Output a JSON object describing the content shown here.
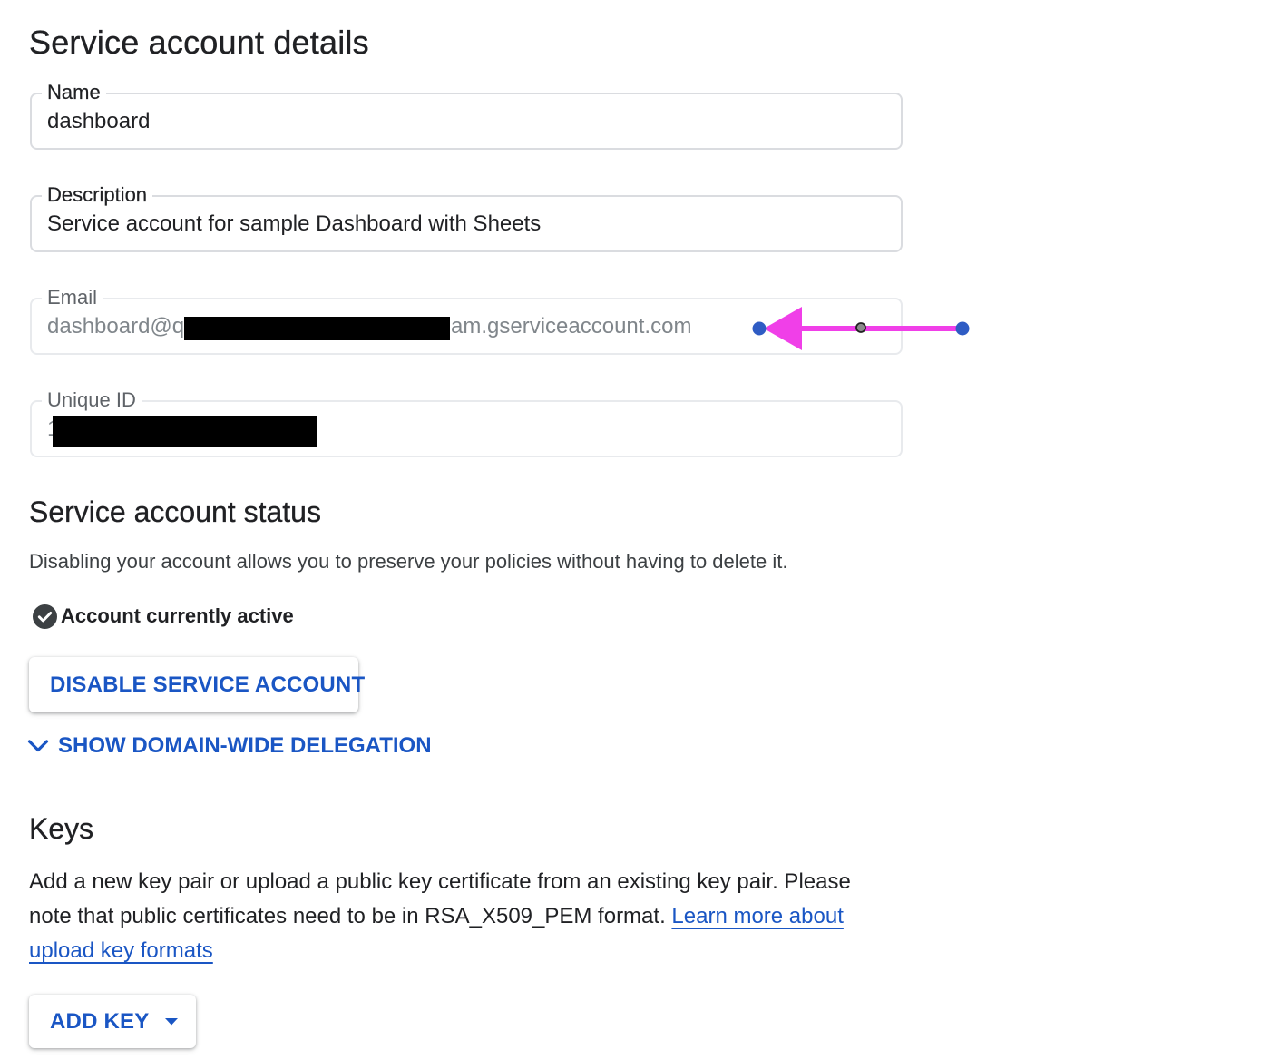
{
  "details": {
    "title": "Service account details",
    "name": {
      "label": "Name",
      "value": "dashboard"
    },
    "description": {
      "label": "Description",
      "value": "Service account for sample Dashboard with Sheets"
    },
    "email": {
      "label": "Email",
      "value_prefix": "dashboard@q",
      "value_suffix": "am.gserviceaccount.com"
    },
    "unique_id": {
      "label": "Unique ID",
      "value_prefix": "1"
    }
  },
  "status": {
    "title": "Service account status",
    "description": "Disabling your account allows you to preserve your policies without having to delete it.",
    "state_label": "Account currently active",
    "disable_button": "DISABLE SERVICE ACCOUNT",
    "delegation_toggle": "SHOW DOMAIN-WIDE DELEGATION"
  },
  "keys": {
    "title": "Keys",
    "description": "Add a new key pair or upload a public key certificate from an existing key pair. Please note that public certificates need to be in RSA_X509_PEM format.",
    "learn_more_link": "Learn more about upload key formats",
    "add_key_button": "ADD KEY"
  },
  "icons": {
    "status": "check-circle-icon",
    "toggle": "chevron-down-icon",
    "dropdown": "caret-down-icon",
    "annotation": "arrow-annotation-icon"
  },
  "colors": {
    "link_blue": "#1a56c4",
    "annotation_pink": "#f03fe8",
    "handle_blue": "#2f5cc4",
    "field_border": "#dadce0"
  }
}
